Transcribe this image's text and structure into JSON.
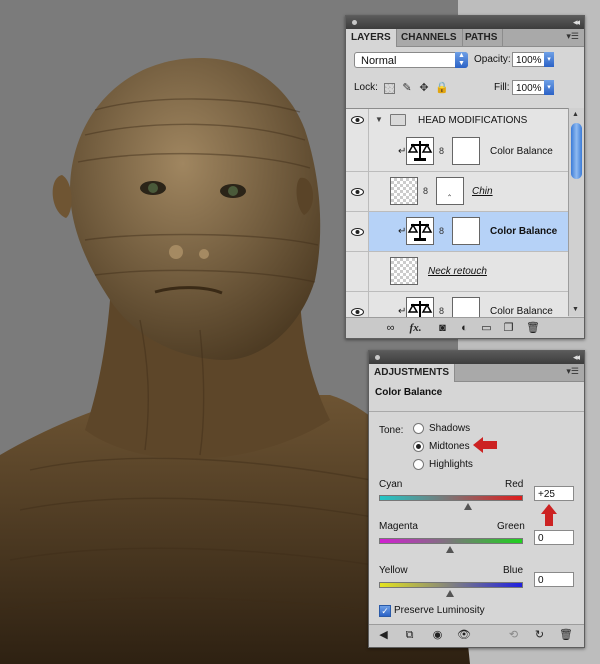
{
  "layers_panel": {
    "tabs": [
      "LAYERS",
      "CHANNELS",
      "PATHS"
    ],
    "active_tab": "LAYERS",
    "blend_mode": "Normal",
    "opacity_label": "Opacity:",
    "opacity_value": "100%",
    "lock_label": "Lock:",
    "fill_label": "Fill:",
    "fill_value": "100%",
    "layers": [
      {
        "name": "HEAD MODIFICATIONS",
        "type": "group",
        "visible": true
      },
      {
        "name": "Color Balance",
        "type": "adjustment",
        "visible": false,
        "selected": false
      },
      {
        "name": "Chin",
        "type": "pixel",
        "visible": true,
        "selected": false
      },
      {
        "name": "Color Balance",
        "type": "adjustment",
        "visible": true,
        "selected": true
      },
      {
        "name": "Neck retouch",
        "type": "pixel",
        "visible": false,
        "selected": false
      },
      {
        "name": "Color Balance",
        "type": "adjustment",
        "visible": true,
        "selected": false
      }
    ],
    "footer_icons": [
      "link-icon",
      "fx-icon",
      "mask-icon",
      "adjustment-icon",
      "group-icon",
      "new-layer-icon",
      "trash-icon"
    ],
    "footer_fx_label": "fx."
  },
  "adjustments_panel": {
    "tab": "ADJUSTMENTS",
    "title": "Color Balance",
    "tone_label": "Tone:",
    "tones": [
      "Shadows",
      "Midtones",
      "Highlights"
    ],
    "selected_tone": "Midtones",
    "sliders": [
      {
        "left": "Cyan",
        "right": "Red",
        "value": "+25",
        "level": 25,
        "left_color": "#22c7c7",
        "right_color": "#e01c1c"
      },
      {
        "left": "Magenta",
        "right": "Green",
        "value": "0",
        "level": 0,
        "left_color": "#d21fd2",
        "right_color": "#1ed21e"
      },
      {
        "left": "Yellow",
        "right": "Blue",
        "value": "0",
        "level": 0,
        "left_color": "#e3e320",
        "right_color": "#2020e0"
      }
    ],
    "preserve_luminosity": "Preserve Luminosity",
    "preserve_checked": true,
    "footer_icons": [
      "back-icon",
      "clip-icon",
      "eye-mask-icon",
      "visibility-icon",
      "previous-state-icon",
      "reset-icon",
      "trash-icon"
    ]
  },
  "annotation_color": "#cc2222",
  "accent_color": "#2b62c6"
}
